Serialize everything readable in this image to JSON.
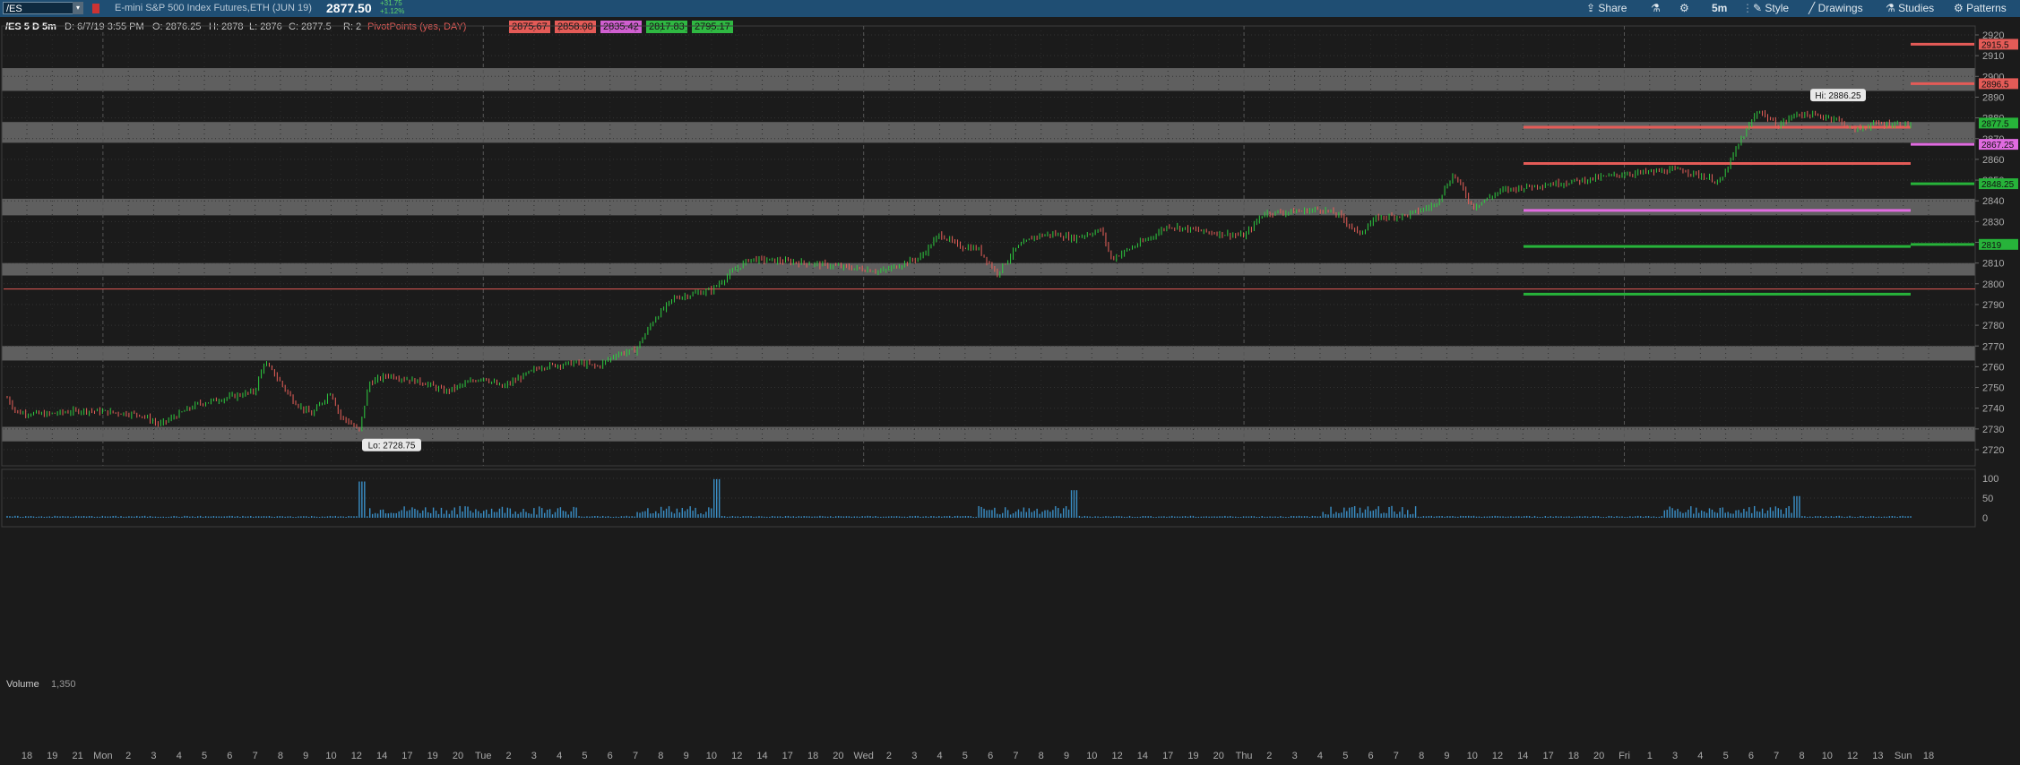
{
  "toolbar": {
    "symbol": "/ES",
    "description": "E-mini S&P 500 Index Futures,ETH (JUN 19)",
    "last_price": "2877.50",
    "change_abs": "+31.75",
    "change_pct": "+1.12%",
    "share_label": "Share",
    "interval_label": "5m",
    "style_label": "Style",
    "drawings_label": "Drawings",
    "studies_label": "Studies",
    "patterns_label": "Patterns"
  },
  "info": {
    "label": "/ES 5 D 5m",
    "date": "D: 6/7/19 3:55 PM",
    "open": "O: 2876.25",
    "high": "H: 2878",
    "low": "L: 2876",
    "close": "C: 2877.5",
    "range": "R: 2",
    "pivot_label": "PivotPoints (yes, DAY)",
    "pivots": [
      "2875.67",
      "2858.08",
      "2835.42",
      "2817.83",
      "2795.17"
    ]
  },
  "colors": {
    "background": "#1b1b1b",
    "grid": "#3a3a3a",
    "up": "#2ecc40",
    "down": "#e8605a",
    "zone": "#777777",
    "red_line": "#e45b57",
    "green_line": "#27b33a",
    "magenta_line": "#e06be0",
    "volume": "#3a8fc7",
    "toolbar": "#1f4e73"
  },
  "chart_data": {
    "type": "candlestick",
    "ylim": [
      2715,
      2925
    ],
    "y_ticks": [
      2720,
      2730,
      2740,
      2750,
      2760,
      2770,
      2780,
      2790,
      2800,
      2810,
      2820,
      2830,
      2840,
      2850,
      2860,
      2870,
      2880,
      2890,
      2900,
      2910,
      2920
    ],
    "x_tick_labels": [
      "18",
      "19",
      "21",
      "Mon",
      "2",
      "3",
      "4",
      "5",
      "6",
      "7",
      "8",
      "9",
      "10",
      "12",
      "14",
      "17",
      "19",
      "20",
      "Tue",
      "2",
      "3",
      "4",
      "5",
      "6",
      "7",
      "8",
      "9",
      "10",
      "12",
      "14",
      "17",
      "18",
      "20",
      "Wed",
      "2",
      "3",
      "4",
      "5",
      "6",
      "7",
      "8",
      "9",
      "10",
      "12",
      "14",
      "17",
      "19",
      "20",
      "Thu",
      "2",
      "3",
      "4",
      "5",
      "6",
      "7",
      "8",
      "9",
      "10",
      "12",
      "14",
      "17",
      "18",
      "20",
      "Fri",
      "1",
      "3",
      "4",
      "5",
      "6",
      "7",
      "8",
      "10",
      "12",
      "13",
      "Sun",
      "18"
    ],
    "day_separators": [
      "Mon",
      "Tue",
      "Wed",
      "Thu",
      "Fri"
    ],
    "price_path": [
      [
        0,
        2745
      ],
      [
        0.005,
        2738
      ],
      [
        0.02,
        2737
      ],
      [
        0.04,
        2739
      ],
      [
        0.07,
        2737
      ],
      [
        0.08,
        2732
      ],
      [
        0.1,
        2742
      ],
      [
        0.12,
        2746
      ],
      [
        0.13,
        2748
      ],
      [
        0.135,
        2762
      ],
      [
        0.14,
        2757
      ],
      [
        0.15,
        2744
      ],
      [
        0.155,
        2740
      ],
      [
        0.16,
        2737
      ],
      [
        0.17,
        2748
      ],
      [
        0.175,
        2736
      ],
      [
        0.18,
        2733
      ],
      [
        0.185,
        2729
      ],
      [
        0.19,
        2752
      ],
      [
        0.2,
        2756
      ],
      [
        0.22,
        2752
      ],
      [
        0.23,
        2748
      ],
      [
        0.25,
        2755
      ],
      [
        0.26,
        2750
      ],
      [
        0.28,
        2760
      ],
      [
        0.3,
        2762
      ],
      [
        0.31,
        2760
      ],
      [
        0.32,
        2766
      ],
      [
        0.33,
        2768
      ],
      [
        0.34,
        2783
      ],
      [
        0.35,
        2793
      ],
      [
        0.37,
        2797
      ],
      [
        0.38,
        2805
      ],
      [
        0.39,
        2812
      ],
      [
        0.42,
        2810
      ],
      [
        0.44,
        2808
      ],
      [
        0.46,
        2806
      ],
      [
        0.48,
        2813
      ],
      [
        0.49,
        2824
      ],
      [
        0.5,
        2818
      ],
      [
        0.51,
        2817
      ],
      [
        0.52,
        2805
      ],
      [
        0.53,
        2817
      ],
      [
        0.54,
        2823
      ],
      [
        0.55,
        2824
      ],
      [
        0.56,
        2822
      ],
      [
        0.575,
        2826
      ],
      [
        0.58,
        2812
      ],
      [
        0.6,
        2822
      ],
      [
        0.61,
        2828
      ],
      [
        0.63,
        2825
      ],
      [
        0.65,
        2823
      ],
      [
        0.66,
        2834
      ],
      [
        0.68,
        2835
      ],
      [
        0.69,
        2836
      ],
      [
        0.7,
        2833
      ],
      [
        0.71,
        2824
      ],
      [
        0.72,
        2832
      ],
      [
        0.735,
        2833
      ],
      [
        0.75,
        2838
      ],
      [
        0.76,
        2853
      ],
      [
        0.77,
        2837
      ],
      [
        0.785,
        2845
      ],
      [
        0.8,
        2847
      ],
      [
        0.82,
        2849
      ],
      [
        0.85,
        2853
      ],
      [
        0.88,
        2855
      ],
      [
        0.9,
        2849
      ],
      [
        0.91,
        2868
      ],
      [
        0.92,
        2884
      ],
      [
        0.93,
        2876
      ],
      [
        0.94,
        2882
      ],
      [
        0.96,
        2880
      ],
      [
        0.97,
        2874
      ],
      [
        0.98,
        2877
      ]
    ],
    "high_label": "Hi: 2886.25",
    "low_label": "Lo: 2728.75",
    "zones": [
      [
        2893,
        2904
      ],
      [
        2868,
        2878
      ],
      [
        2833,
        2841
      ],
      [
        2804,
        2810
      ],
      [
        2763,
        2770
      ],
      [
        2724,
        2731
      ]
    ],
    "horizontal_lines": [
      {
        "value": 2797.5,
        "color": "red_line",
        "span": "full"
      },
      {
        "value": 2875.5,
        "color": "red_line",
        "span": "thursday-friday"
      },
      {
        "value": 2858,
        "color": "red_line",
        "span": "thursday-friday"
      },
      {
        "value": 2835.4,
        "color": "magenta_line",
        "span": "thursday-friday"
      },
      {
        "value": 2818,
        "color": "green_line",
        "span": "thursday-friday"
      },
      {
        "value": 2795,
        "color": "green_line",
        "span": "thursday-friday"
      },
      {
        "value": 2915.5,
        "color": "red_line",
        "span": "future"
      },
      {
        "value": 2896.5,
        "color": "red_line",
        "span": "future"
      },
      {
        "value": 2867.25,
        "color": "magenta_line",
        "span": "future"
      },
      {
        "value": 2848.25,
        "color": "green_line",
        "span": "future"
      },
      {
        "value": 2819,
        "color": "green_line",
        "span": "future"
      }
    ],
    "price_tags": [
      {
        "value": 2915.5,
        "label": "2915.5",
        "color": "#e45b57"
      },
      {
        "value": 2896.5,
        "label": "2896.5",
        "color": "#e45b57"
      },
      {
        "value": 2877.5,
        "label": "2877.5",
        "color": "#27b33a"
      },
      {
        "value": 2867.25,
        "label": "2867.25",
        "color": "#e06be0"
      },
      {
        "value": 2848.25,
        "label": "2848.25",
        "color": "#27b33a"
      },
      {
        "value": 2819,
        "label": "2819",
        "color": "#27b33a"
      }
    ],
    "volume": {
      "label": "Volume",
      "current": "1,350",
      "ticks": [
        100,
        50,
        0
      ]
    }
  }
}
